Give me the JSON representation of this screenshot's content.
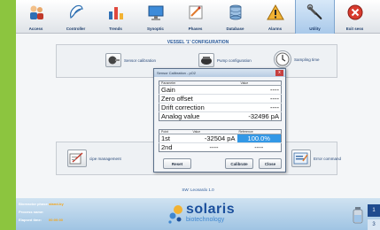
{
  "toolbar": {
    "items": [
      {
        "label": "Access",
        "icon": "access-icon"
      },
      {
        "label": "Controller",
        "icon": "controller-icon"
      },
      {
        "label": "Trends",
        "icon": "trends-icon"
      },
      {
        "label": "Synoptic",
        "icon": "synoptic-icon"
      },
      {
        "label": "Phases",
        "icon": "phases-icon"
      },
      {
        "label": "Database",
        "icon": "database-icon"
      },
      {
        "label": "Alarms",
        "icon": "alarms-icon"
      },
      {
        "label": "Utility",
        "icon": "utility-icon",
        "active": true
      },
      {
        "label": "Exit sess",
        "icon": "exit-icon"
      }
    ]
  },
  "config": {
    "title": "VESSEL '1' CONFIGURATION",
    "sensor_calibration": "Sensor calibration",
    "pump_configuration": "Pump configuration",
    "sampling_time": "Sampling time"
  },
  "lower": {
    "recipe_management": "cipe management",
    "error_command": "Error command"
  },
  "sw_line": "SW: Leonardo 1.0",
  "bottom": {
    "rows": [
      {
        "key": "Bioreactor phase:",
        "value": "stand-by"
      },
      {
        "key": "Process name:",
        "value": ""
      },
      {
        "key": "Elapsed time:",
        "value": "00:00:00"
      }
    ],
    "logo_main": "solaris",
    "logo_sub": "biotechnology",
    "page": "1",
    "page_next": "3"
  },
  "dialog": {
    "title": "Sensor Calibration - pO2",
    "close": "x",
    "param_header": "Parameter",
    "value_header": "Value",
    "params": [
      {
        "name": "Gain",
        "value": "----"
      },
      {
        "name": "Zero offset",
        "value": "----"
      },
      {
        "name": "Drift correction",
        "value": "----"
      },
      {
        "name": "Analog value",
        "value": "-32496 pA"
      }
    ],
    "point_header": "Point",
    "point_value_header": "Value",
    "reference_header": "Reference",
    "points": [
      {
        "name": "1st",
        "value": "-32504 pA",
        "reference": "100.0%"
      },
      {
        "name": "2nd",
        "value": "----",
        "reference": "----"
      }
    ],
    "reset": "Reset",
    "calibrate": "Calibrate",
    "close_button": "Close"
  },
  "colors": {
    "frame": "#8cc53f",
    "accent": "#1f4b8f",
    "selection": "#3398e6"
  }
}
